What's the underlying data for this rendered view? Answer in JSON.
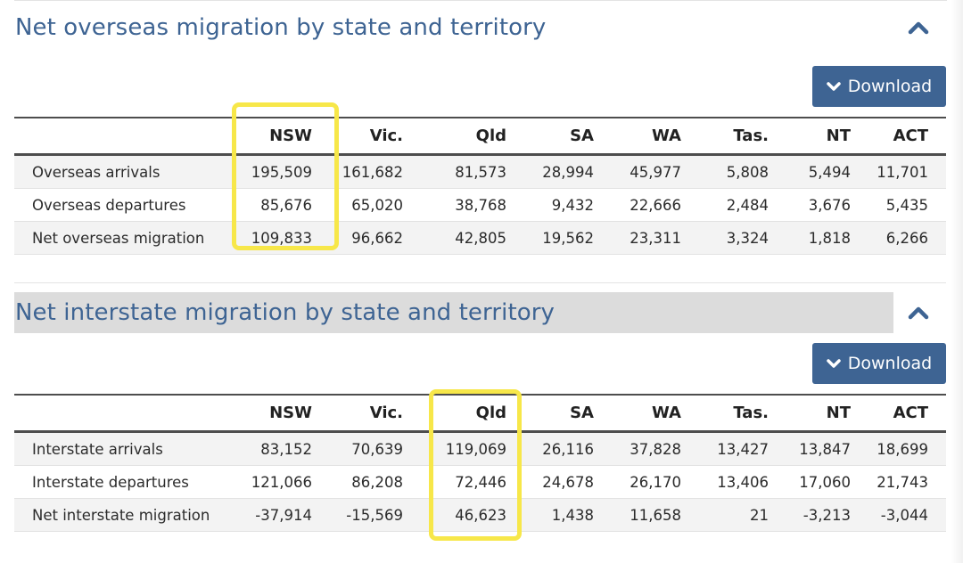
{
  "sections": [
    {
      "title": "Net overseas migration by state and territory",
      "collapse_icon": "chevron-up-icon",
      "download": {
        "label": "Download",
        "icon": "chevron-down-icon"
      },
      "columns": [
        "",
        "NSW",
        "Vic.",
        "Qld",
        "SA",
        "WA",
        "Tas.",
        "NT",
        "ACT"
      ],
      "rows": [
        {
          "label": "Overseas arrivals",
          "values": [
            "195,509",
            "161,682",
            "81,573",
            "28,994",
            "45,977",
            "5,808",
            "5,494",
            "11,701"
          ]
        },
        {
          "label": "Overseas departures",
          "values": [
            "85,676",
            "65,020",
            "38,768",
            "9,432",
            "22,666",
            "2,484",
            "3,676",
            "5,435"
          ]
        },
        {
          "label": "Net overseas migration",
          "values": [
            "109,833",
            "96,662",
            "42,805",
            "19,562",
            "23,311",
            "3,324",
            "1,818",
            "6,266"
          ]
        }
      ],
      "highlighted_column": "NSW"
    },
    {
      "title": "Net interstate migration by state and territory",
      "collapse_icon": "chevron-up-icon",
      "download": {
        "label": "Download",
        "icon": "chevron-down-icon"
      },
      "columns": [
        "",
        "NSW",
        "Vic.",
        "Qld",
        "SA",
        "WA",
        "Tas.",
        "NT",
        "ACT"
      ],
      "rows": [
        {
          "label": "Interstate arrivals",
          "values": [
            "83,152",
            "70,639",
            "119,069",
            "26,116",
            "37,828",
            "13,427",
            "13,847",
            "18,699"
          ]
        },
        {
          "label": "Interstate departures",
          "values": [
            "121,066",
            "86,208",
            "72,446",
            "24,678",
            "26,170",
            "13,406",
            "17,060",
            "21,743"
          ]
        },
        {
          "label": "Net interstate migration",
          "values": [
            "-37,914",
            "-15,569",
            "46,623",
            "1,438",
            "11,658",
            "21",
            "-3,213",
            "-3,044"
          ]
        }
      ],
      "highlighted_column": "Qld"
    }
  ],
  "colors": {
    "title": "#3e6493",
    "button": "#3e6493",
    "highlight": "#f7e749",
    "shaded_title_bg": "#dcdcdc"
  }
}
